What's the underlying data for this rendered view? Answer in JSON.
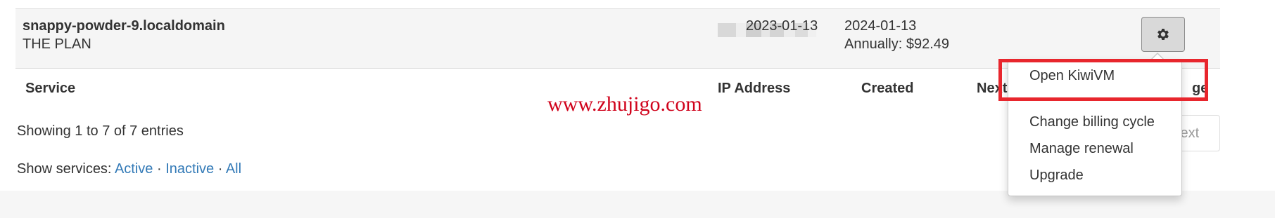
{
  "service_row": {
    "hostname": "snappy-powder-9.localdomain",
    "plan": "THE PLAN",
    "created": "2023-01-13",
    "next_due": "2024-01-13",
    "billing": "Annually: $92.49"
  },
  "table_headers": {
    "service": "Service",
    "ip_address": "IP Address",
    "created": "Created",
    "next_due": "Next",
    "manage_tail": "ge"
  },
  "watermark": "www.zhujigo.com",
  "showing": "Showing 1 to 7 of 7 entries",
  "pager": {
    "next": "Next"
  },
  "filter": {
    "prefix": "Show services: ",
    "active": "Active",
    "inactive": "Inactive",
    "all": "All",
    "separator": " · "
  },
  "dropdown": {
    "items": [
      "Open KiwiVM",
      "Change billing cycle",
      "Manage renewal",
      "Upgrade"
    ]
  },
  "colors": {
    "link": "#337ab7",
    "highlight": "#e8262d",
    "watermark": "#d0021b"
  },
  "icons": {
    "gear": "gear-icon"
  }
}
